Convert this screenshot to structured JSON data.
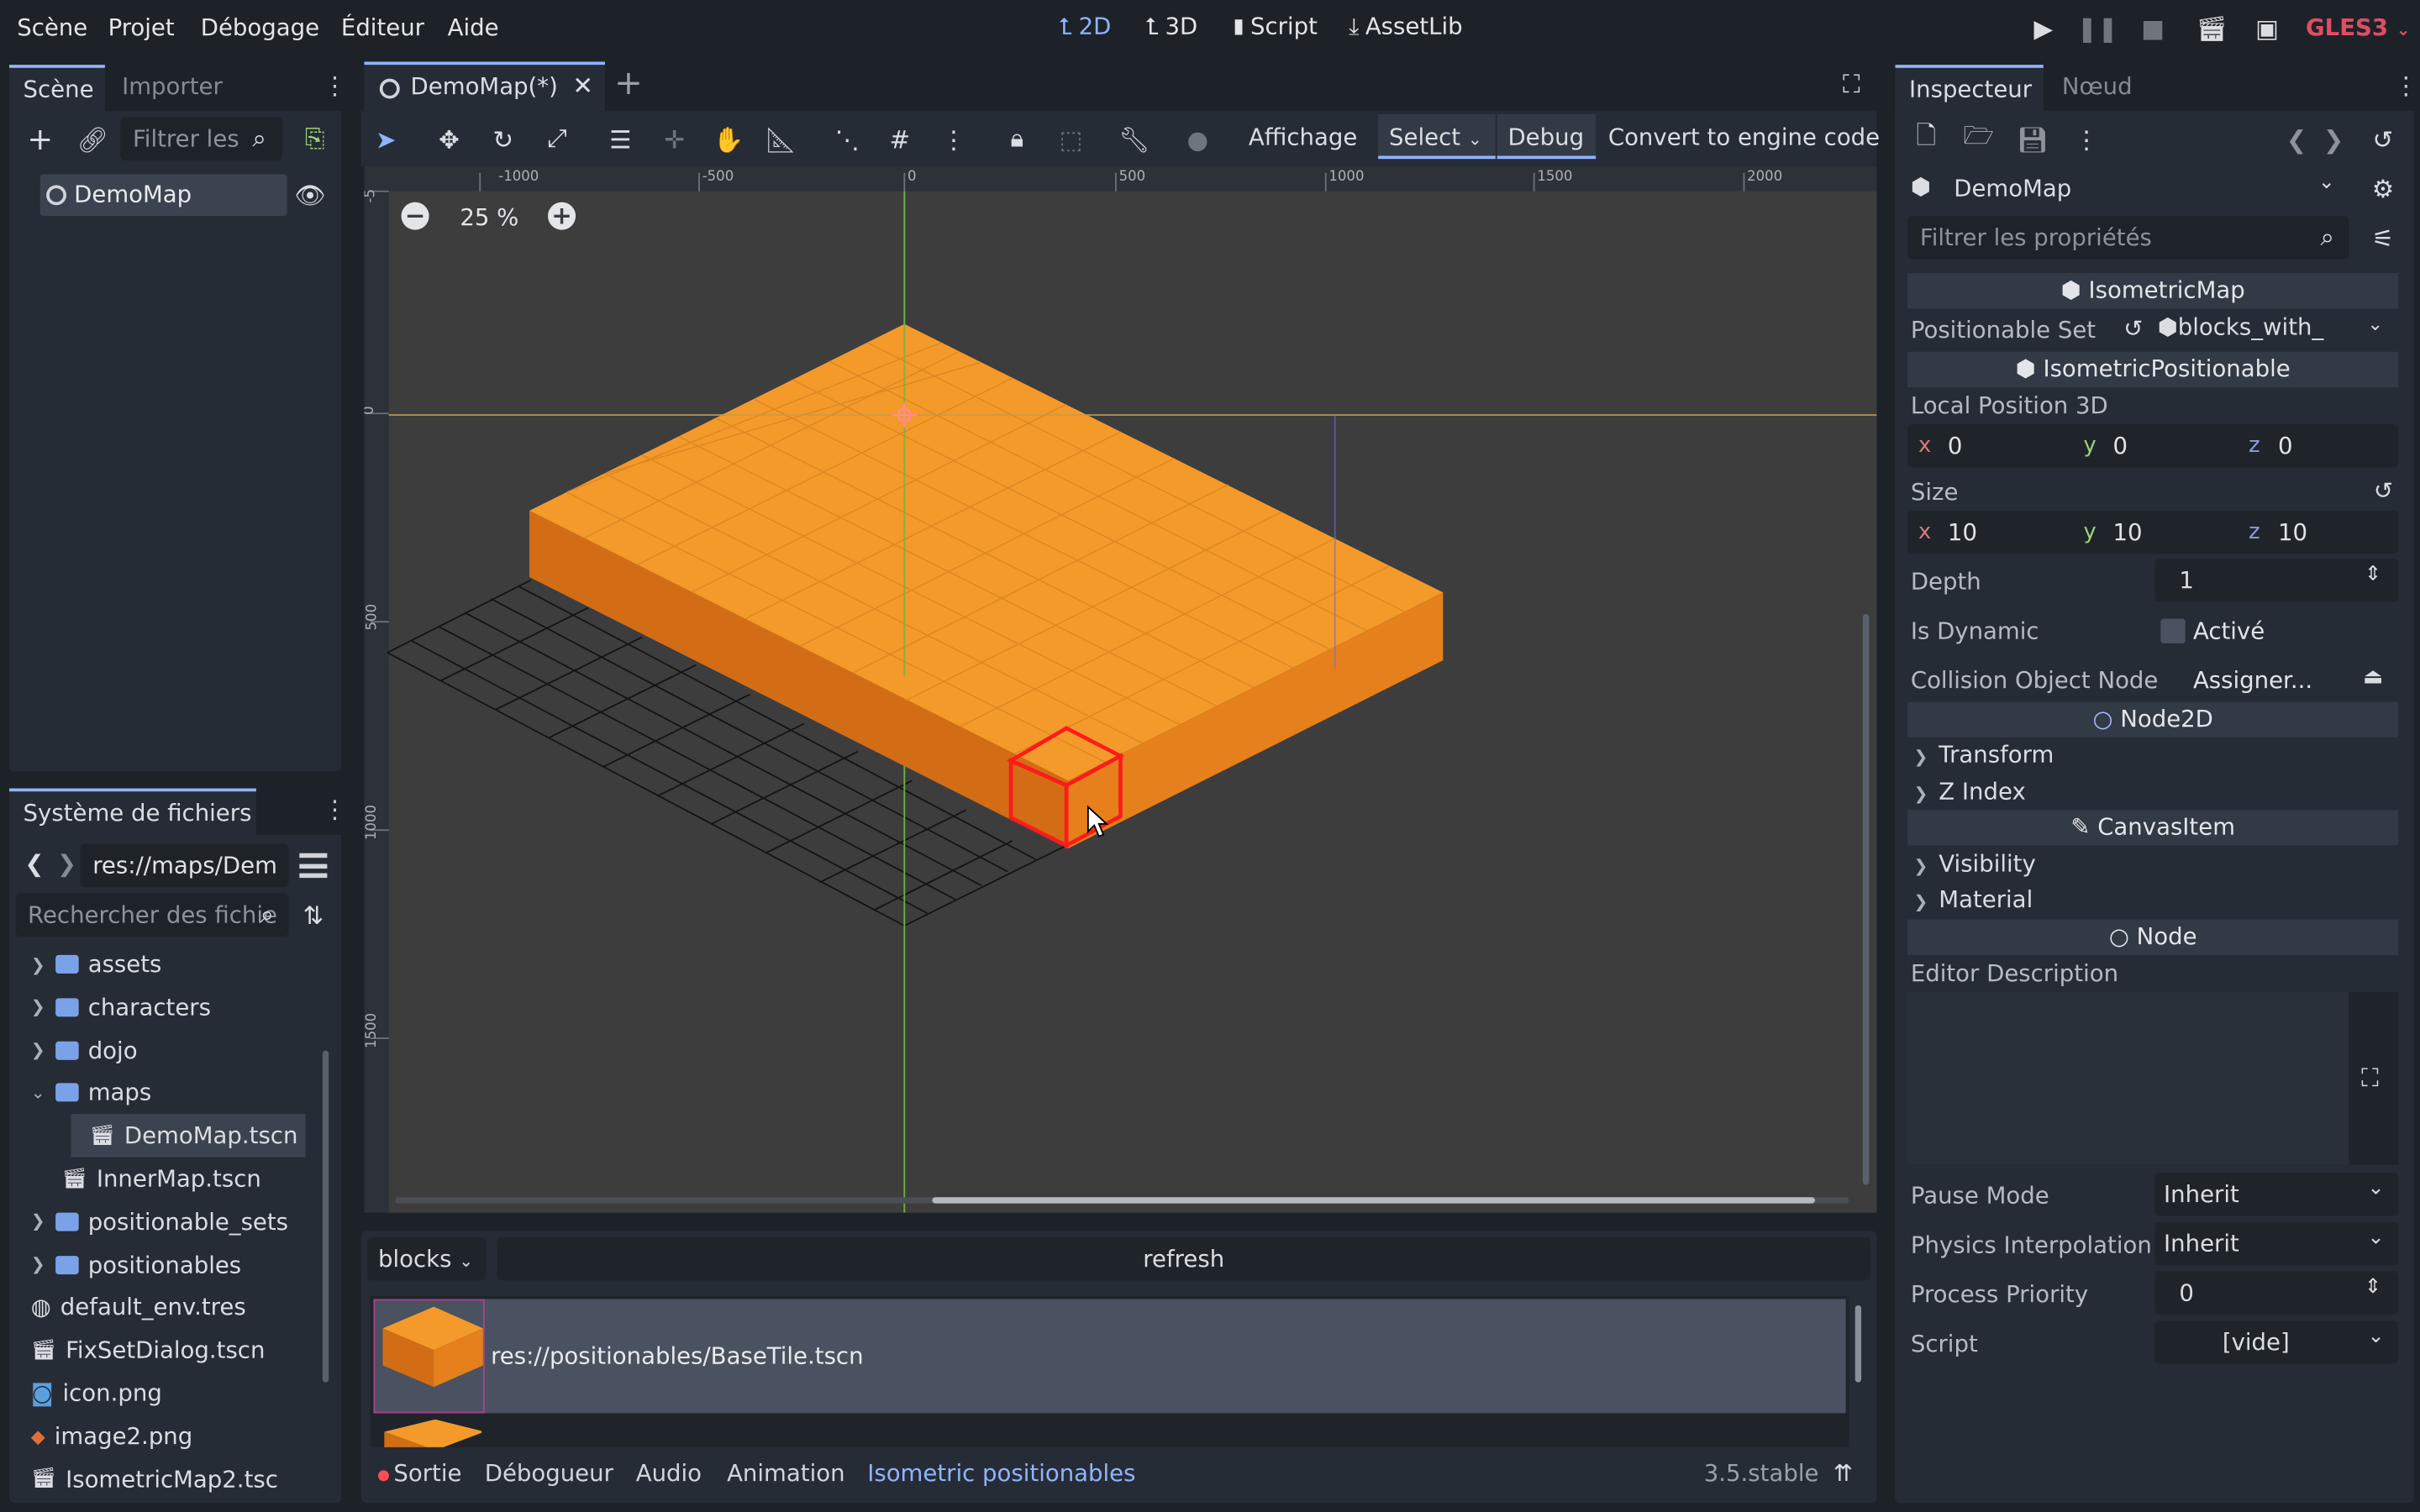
{
  "menubar": {
    "items": [
      "Scène",
      "Projet",
      "Débogage",
      "Éditeur",
      "Aide"
    ],
    "workspaces": [
      "2D",
      "3D",
      "Script",
      "AssetLib"
    ],
    "renderer": "GLES3"
  },
  "scene_dock": {
    "tabs": [
      "Scène",
      "Importer"
    ],
    "filter_placeholder": "Filtrer les",
    "root_node": "DemoMap"
  },
  "filesystem_dock": {
    "title": "Système de fichiers",
    "path": "res://maps/Dem",
    "search_placeholder": "Rechercher des fichie",
    "items": [
      {
        "label": "assets",
        "type": "folder",
        "expanded": false,
        "depth": 0
      },
      {
        "label": "characters",
        "type": "folder",
        "expanded": false,
        "depth": 0
      },
      {
        "label": "dojo",
        "type": "folder",
        "expanded": false,
        "depth": 0
      },
      {
        "label": "maps",
        "type": "folder",
        "expanded": true,
        "depth": 0
      },
      {
        "label": "DemoMap.tscn",
        "type": "scene",
        "depth": 1,
        "selected": true
      },
      {
        "label": "InnerMap.tscn",
        "type": "scene",
        "depth": 1
      },
      {
        "label": "positionable_sets",
        "type": "folder",
        "expanded": false,
        "depth": 0
      },
      {
        "label": "positionables",
        "type": "folder",
        "expanded": false,
        "depth": 0
      },
      {
        "label": "default_env.tres",
        "type": "env",
        "depth": 0
      },
      {
        "label": "FixSetDialog.tscn",
        "type": "scene",
        "depth": 0
      },
      {
        "label": "icon.png",
        "type": "image",
        "depth": 0
      },
      {
        "label": "image2.png",
        "type": "image2",
        "depth": 0
      },
      {
        "label": "IsometricMap2.tsc",
        "type": "scene",
        "depth": 0
      }
    ]
  },
  "editor": {
    "tab_title": "DemoMap(*)",
    "toolbar": {
      "view_label": "Affichage",
      "select_label": "Select",
      "debug_label": "Debug",
      "convert_label": "Convert to engine code"
    },
    "zoom": "25 %",
    "ruler_labels": [
      "-1000",
      "-500",
      "0",
      "500",
      "1000",
      "1500",
      "2000"
    ],
    "ruler_v_labels": [
      "-5",
      "0",
      "500",
      "1000",
      "1500"
    ]
  },
  "bottom_panel": {
    "set_select": "blocks",
    "refresh_label": "refresh",
    "item_path": "res://positionables/BaseTile.tscn",
    "tabs": [
      "Sortie",
      "Débogueur",
      "Audio",
      "Animation",
      "Isometric positionables"
    ],
    "active_tab": "Isometric positionables",
    "version": "3.5.stable"
  },
  "inspector": {
    "tabs": [
      "Inspecteur",
      "Nœud"
    ],
    "object_name": "DemoMap",
    "filter_placeholder": "Filtrer les propriétés",
    "sections": {
      "isometric_map": "IsometricMap",
      "isometric_positionable": "IsometricPositionable",
      "node2d": "Node2D",
      "canvas_item": "CanvasItem",
      "node": "Node"
    },
    "positionable_set_label": "Positionable Set",
    "positionable_set_value": "blocks_with_",
    "local_position_label": "Local Position 3D",
    "local_position": {
      "x": "0",
      "y": "0",
      "z": "0"
    },
    "size_label": "Size",
    "size": {
      "x": "10",
      "y": "10",
      "z": "10"
    },
    "depth_label": "Depth",
    "depth_value": "1",
    "is_dynamic_label": "Is Dynamic",
    "is_dynamic_value": "Activé",
    "collision_label": "Collision Object Node",
    "collision_value": "Assigner...",
    "transform_label": "Transform",
    "zindex_label": "Z Index",
    "visibility_label": "Visibility",
    "material_label": "Material",
    "editor_desc_label": "Editor Description",
    "pause_mode_label": "Pause Mode",
    "pause_mode_value": "Inherit",
    "physics_interp_label": "Physics Interpolation",
    "physics_interp_value": "Inherit",
    "process_priority_label": "Process Priority",
    "process_priority_value": "0",
    "script_label": "Script",
    "script_value": "[vide]",
    "axis_x": "x",
    "axis_y": "y",
    "axis_z": "z"
  },
  "colors": {
    "accent": "#8fb4ff",
    "block_top": "#f39a2a",
    "block_left": "#d26d16",
    "block_right": "#e5801c",
    "selection": "#ff1a1a"
  }
}
